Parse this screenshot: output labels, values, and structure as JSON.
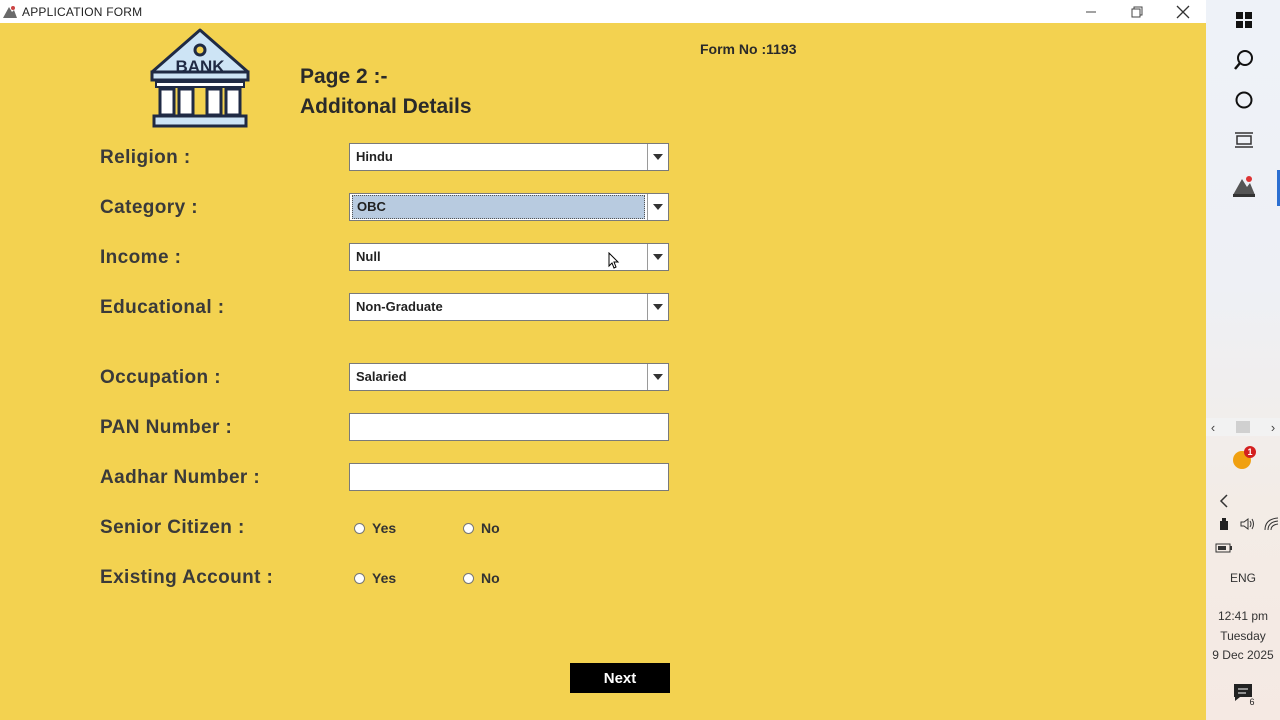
{
  "window": {
    "title": "APPLICATION FORM",
    "minimize": "—",
    "restore": "❐",
    "close": "✕"
  },
  "logo": {
    "text": "BANK"
  },
  "page": {
    "heading_line1": "Page 2 :-",
    "heading_line2": "Additonal Details",
    "form_no": "Form No :1193"
  },
  "fields": {
    "religion": {
      "label": "Religion :",
      "value": "Hindu"
    },
    "category": {
      "label": "Category :",
      "value": "OBC"
    },
    "income": {
      "label": "Income :",
      "value": "Null"
    },
    "educational": {
      "label": "Educational :",
      "value": "Non-Graduate"
    },
    "occupation": {
      "label": "Occupation :",
      "value": "Salaried"
    },
    "pan": {
      "label": "PAN Number :",
      "value": ""
    },
    "aadhar": {
      "label": "Aadhar Number :",
      "value": ""
    },
    "senior_citizen": {
      "label": "Senior Citizen :",
      "options": [
        "Yes",
        "No"
      ]
    },
    "existing_account": {
      "label": "Existing Account :",
      "options": [
        "Yes",
        "No"
      ]
    }
  },
  "next_button": "Next",
  "taskbar": {
    "language": "ENG",
    "time": "12:41 pm",
    "day": "Tuesday",
    "date": "9 Dec 2025",
    "notification_badge": "1",
    "chat_count": "6"
  },
  "colors": {
    "background": "#f3d250",
    "button": "#000000",
    "focus_highlight": "#b8cbe0"
  }
}
